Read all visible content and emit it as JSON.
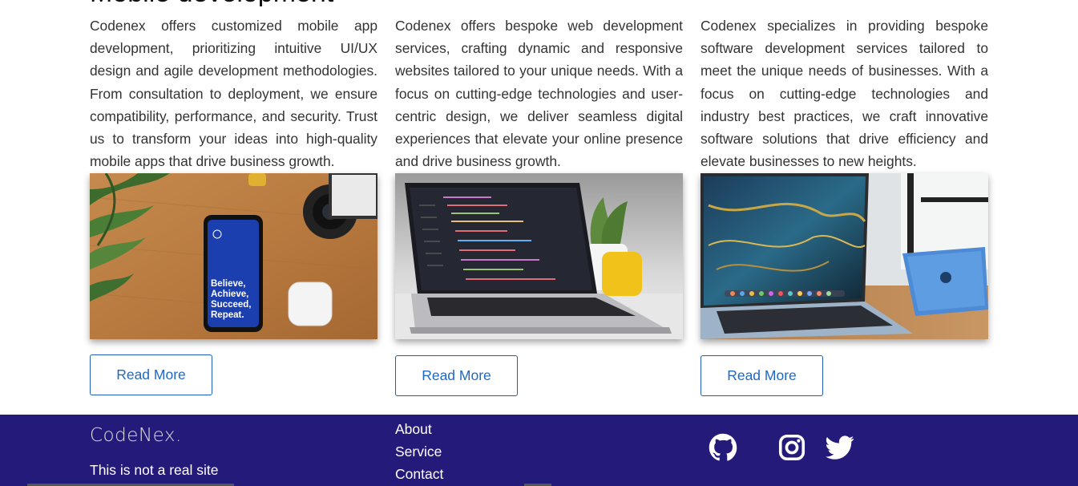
{
  "services": [
    {
      "heading": "Mobile development",
      "description": "Codenex offers customized mobile app development, prioritizing intuitive UI/UX design and agile development methodologies. From consultation to deployment, we ensure compatibility, performance, and security. Trust us to transform your ideas into high-quality mobile apps that drive business growth.",
      "image": "phone-on-desk-image",
      "button": "Read More"
    },
    {
      "heading": "",
      "description": "Codenex offers bespoke web development services, crafting dynamic and responsive websites tailored to your unique needs. With a focus on cutting-edge technologies and user-centric design, we deliver seamless digital experiences that elevate your online presence and drive business growth.",
      "image": "laptop-code-image",
      "button": "Read More"
    },
    {
      "heading": "",
      "description": "Codenex specializes in providing bespoke software development services tailored to meet the unique needs of businesses. With a focus on cutting-edge technologies and industry best practices, we craft innovative software solutions that drive efficiency and elevate businesses to new heights.",
      "image": "laptop-tablet-image",
      "button": "Read More"
    }
  ],
  "phone_screen_text": "Believe, Achieve, Succeed, Repeat.",
  "footer": {
    "logo": "CodeNex.",
    "tagline": "This is not a real site",
    "links": [
      "About",
      "Service",
      "Contact"
    ],
    "social": [
      "github-icon",
      "instagram-icon",
      "twitter-icon"
    ]
  },
  "colors": {
    "footer_bg": "#231a7a",
    "button_border": "#1e5fb3",
    "button_text": "#1f69c4"
  }
}
